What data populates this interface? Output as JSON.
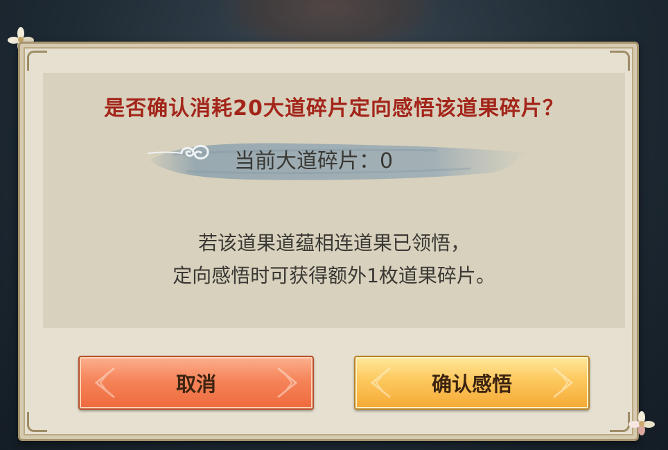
{
  "dialog": {
    "title": "是否确认消耗20大道碎片定向感悟该道果碎片？",
    "fragment_label": "当前大道碎片：",
    "fragment_count": "0",
    "description_line1": "若该道果道蕴相连道果已领悟，",
    "description_line2": "定向感悟时可获得额外1枚道果碎片。"
  },
  "buttons": {
    "cancel_label": "取消",
    "confirm_label": "确认感悟"
  },
  "icons": {
    "banner_icon": "swirl-cloud-icon",
    "top_left_ornament": "flower-ornament-icon",
    "bottom_right_ornament": "flower-ornament-icon"
  },
  "colors": {
    "title": "#a3251a",
    "panel": "#d8d1bd",
    "frame": "#e6e0d0",
    "cancel_button": "#f5845a",
    "confirm_button": "#fcc85d"
  }
}
